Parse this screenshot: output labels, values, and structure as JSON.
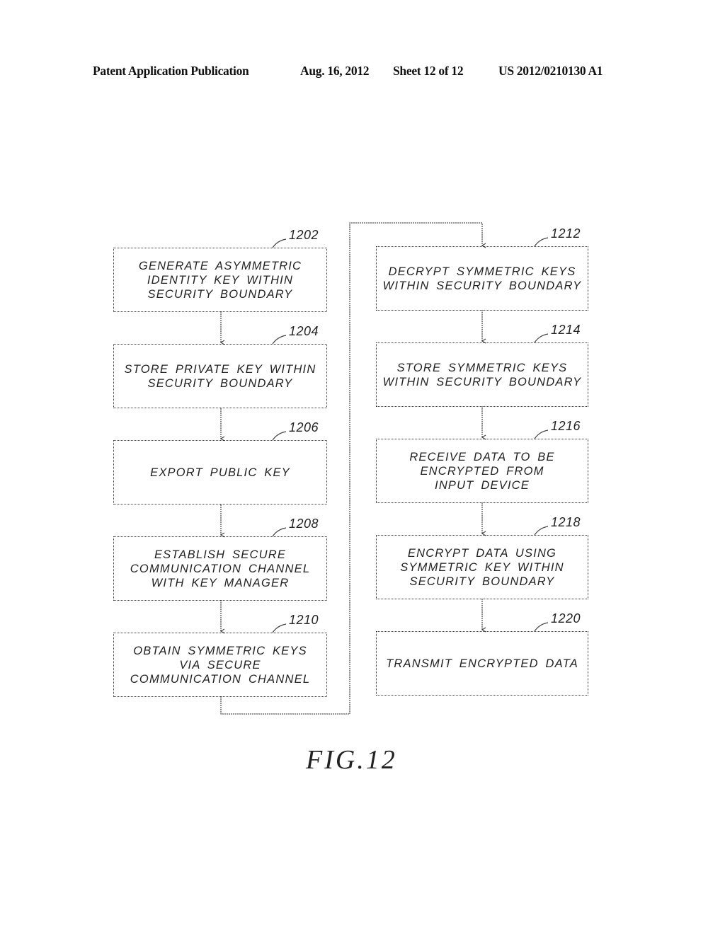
{
  "header": {
    "publication": "Patent Application Publication",
    "date": "Aug. 16, 2012",
    "sheet": "Sheet 12 of 12",
    "number": "US 2012/0210130 A1"
  },
  "figure_label": "FIG.12",
  "steps": [
    {
      "ref": "1202",
      "text": "GENERATE ASYMMETRIC\nIDENTITY KEY WITHIN\nSECURITY BOUNDARY"
    },
    {
      "ref": "1204",
      "text": "STORE PRIVATE KEY WITHIN\nSECURITY BOUNDARY"
    },
    {
      "ref": "1206",
      "text": "EXPORT PUBLIC KEY"
    },
    {
      "ref": "1208",
      "text": "ESTABLISH SECURE\nCOMMUNICATION CHANNEL\nWITH KEY MANAGER"
    },
    {
      "ref": "1210",
      "text": "OBTAIN SYMMETRIC KEYS\nVIA SECURE\nCOMMUNICATION CHANNEL"
    },
    {
      "ref": "1212",
      "text": "DECRYPT SYMMETRIC KEYS\nWITHIN SECURITY BOUNDARY"
    },
    {
      "ref": "1214",
      "text": "STORE SYMMETRIC KEYS\nWITHIN SECURITY BOUNDARY"
    },
    {
      "ref": "1216",
      "text": "RECEIVE DATA TO BE\nENCRYPTED FROM\nINPUT DEVICE"
    },
    {
      "ref": "1218",
      "text": "ENCRYPT DATA USING\nSYMMETRIC KEY WITHIN\nSECURITY BOUNDARY"
    },
    {
      "ref": "1220",
      "text": "TRANSMIT ENCRYPTED DATA"
    }
  ]
}
